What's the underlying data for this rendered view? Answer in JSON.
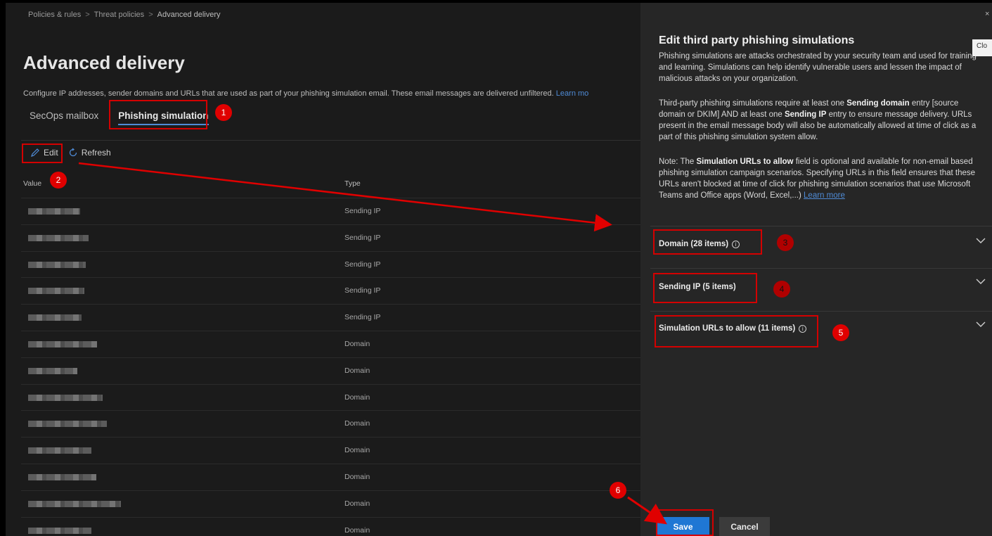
{
  "breadcrumb": [
    "Policies & rules",
    "Threat policies",
    "Advanced delivery"
  ],
  "page_title": "Advanced delivery",
  "description": "Configure IP addresses, sender domains and URLs that are used as part of your phishing simulation email. These email messages are delivered unfiltered.",
  "description_link": "Learn mo",
  "tabs": [
    {
      "label": "SecOps mailbox"
    },
    {
      "label": "Phishing simulation"
    }
  ],
  "toolbar": {
    "edit": "Edit",
    "refresh": "Refresh"
  },
  "table": {
    "columns": [
      "Value",
      "Type"
    ],
    "rows": [
      {
        "type": "Sending IP"
      },
      {
        "type": "Sending IP"
      },
      {
        "type": "Sending IP"
      },
      {
        "type": "Sending IP"
      },
      {
        "type": "Sending IP"
      },
      {
        "type": "Domain"
      },
      {
        "type": "Domain"
      },
      {
        "type": "Domain"
      },
      {
        "type": "Domain"
      },
      {
        "type": "Domain"
      },
      {
        "type": "Domain"
      },
      {
        "type": "Domain"
      },
      {
        "type": "Domain"
      }
    ]
  },
  "panel": {
    "title": "Edit third party phishing simulations",
    "p1": "Phishing simulations are attacks orchestrated by your security team and used for training and learning. Simulations can help identify vulnerable users and lessen the impact of malicious attacks on your organization.",
    "p2_a": "Third-party phishing simulations require at least one ",
    "p2_b": "Sending domain",
    "p2_c": " entry [source domain or DKIM] AND at least one ",
    "p2_d": "Sending IP",
    "p2_e": " entry to ensure message delivery. URLs present in the email message body will also be automatically allowed at time of click as a part of this phishing simulation system allow.",
    "p3_a": "Note: The ",
    "p3_b": "Simulation URLs to allow",
    "p3_c": " field is optional and available for non-email based phishing simulation campaign scenarios. Specifying URLs in this field ensures that these URLs aren't blocked at time of click for phishing simulation scenarios that use Microsoft Teams and Office apps (Word, Excel,...)",
    "p3_link": "Learn more",
    "sections": {
      "domain": "Domain (28 items)",
      "sending_ip": "Sending IP (5 items)",
      "urls": "Simulation URLs to allow (11 items)"
    },
    "save": "Save",
    "cancel": "Cancel"
  },
  "tooltip": "Clo",
  "close_glyph": "×",
  "info_glyph": "i",
  "badges": [
    "1",
    "2",
    "3",
    "4",
    "5",
    "6"
  ],
  "colors": {
    "accent": "#1f77d4",
    "annotation": "#d40000"
  }
}
